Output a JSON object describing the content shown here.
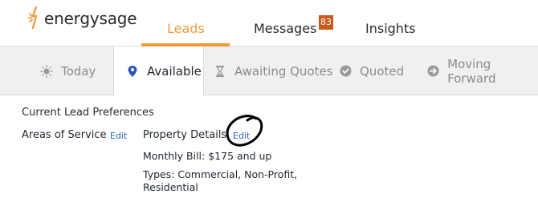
{
  "brand": {
    "name": "energysage",
    "accent": "#f29a3a"
  },
  "nav": {
    "tabs": [
      {
        "label": "Leads",
        "active": true
      },
      {
        "label": "Messages",
        "badge": "83"
      },
      {
        "label": "Insights"
      }
    ]
  },
  "subnav": {
    "tabs": [
      {
        "label": "Today",
        "icon": "sun-icon"
      },
      {
        "label": "Available",
        "icon": "map-pin-icon",
        "active": true
      },
      {
        "label": "Awaiting Quotes",
        "icon": "hourglass-icon"
      },
      {
        "label": "Quoted",
        "icon": "check-circle-icon"
      },
      {
        "label": "Moving Forward",
        "icon": "arrow-circle-icon"
      }
    ]
  },
  "preferences": {
    "title": "Current Lead Preferences",
    "areas_label": "Areas of Service",
    "areas_edit": "Edit",
    "property_label": "Property Details",
    "property_edit": "Edit",
    "monthly_label": "Monthly Bill:",
    "monthly_value": "$175 and up",
    "types_label": "Types:",
    "types_value_line1": "Commercial, Non-Profit,",
    "types_value_line2": "Residential"
  }
}
